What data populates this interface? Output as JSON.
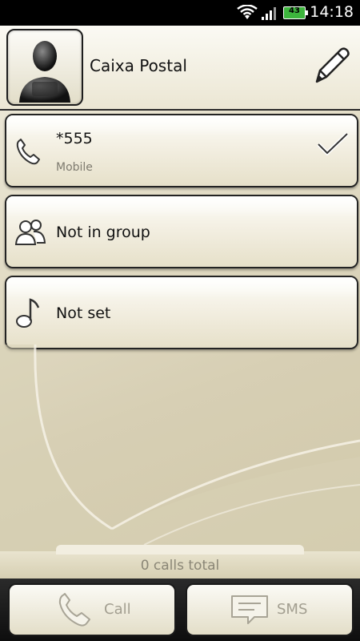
{
  "status_bar": {
    "time": "14:18",
    "battery_level": "43"
  },
  "contact": {
    "name": "Caixa Postal"
  },
  "details": {
    "phone": {
      "number": "*555",
      "type": "Mobile"
    },
    "group": {
      "label": "Not in group"
    },
    "ringtone": {
      "label": "Not set"
    }
  },
  "calls_total": "0 calls total",
  "footer": {
    "call_label": "Call",
    "sms_label": "SMS"
  },
  "icons": {
    "wifi": "wifi-icon",
    "signal": "signal-icon",
    "battery": "battery-icon",
    "avatar": "person-silhouette-icon",
    "edit": "pencil-icon",
    "phone": "phone-icon",
    "group": "group-icon",
    "ringtone": "music-note-icon",
    "check": "check-icon",
    "call": "phone-icon",
    "sms": "message-icon"
  },
  "colors": {
    "background": "#e2dcc6",
    "text": "#111111",
    "muted": "#8a8676",
    "battery": "#3db53d"
  }
}
